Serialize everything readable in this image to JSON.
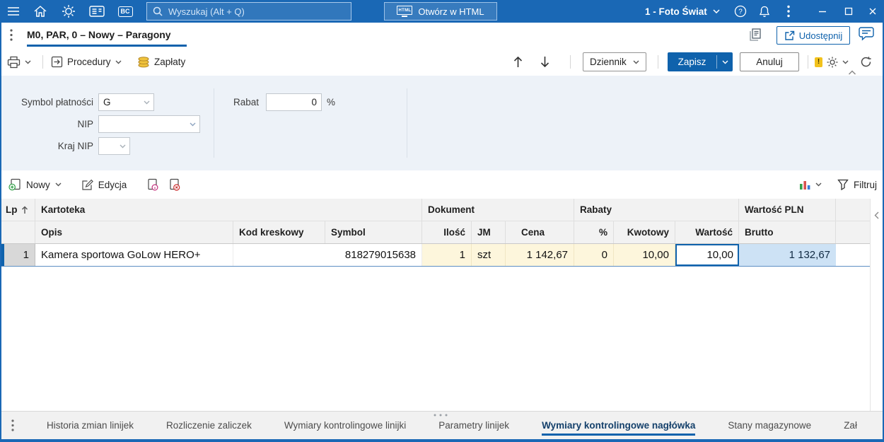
{
  "colors": {
    "topbar_blue": "#1a68b5",
    "accent_blue": "#0f62ac",
    "row_highlight_yellow": "#fdf6dc",
    "cell_highlight_blue": "#cde2f5"
  },
  "topbar": {
    "bc_badge": "BC",
    "search_placeholder": "Wyszukaj (Alt + Q)",
    "open_html_button": "Otwórz w HTML",
    "html_icon_text": "HTML",
    "company_name": "1 - Foto Świat"
  },
  "page_header": {
    "title": "M0, PAR, 0 – Nowy – Paragony",
    "share_button": "Udostępnij"
  },
  "toolbar": {
    "procedures": "Procedury",
    "payments": "Zapłaty",
    "journal_select": "Dziennik",
    "save_button": "Zapisz",
    "cancel_button": "Anuluj",
    "warning_badge": "!"
  },
  "form": {
    "symbol_platnosci_label": "Symbol płatności",
    "symbol_platnosci_value": "G",
    "nip_label": "NIP",
    "nip_value": "",
    "kraj_nip_label": "Kraj NIP",
    "kraj_nip_value": "",
    "rabat_label": "Rabat",
    "rabat_value": "0",
    "rabat_suffix": "%"
  },
  "grid_toolbar": {
    "new": "Nowy",
    "edit": "Edycja",
    "filter": "Filtruj"
  },
  "table": {
    "group_headers": {
      "lp": "Lp",
      "kartoteka": "Kartoteka",
      "dokument": "Dokument",
      "rabaty": "Rabaty",
      "wartosc_pln": "Wartość PLN"
    },
    "columns": {
      "opis": "Opis",
      "kod_kreskowy": "Kod kreskowy",
      "symbol": "Symbol",
      "ilosc": "Ilość",
      "jm": "JM",
      "cena": "Cena",
      "procent": "%",
      "kwotowy": "Kwotowy",
      "wartosc": "Wartość",
      "brutto": "Brutto"
    },
    "rows": [
      {
        "lp": "1",
        "opis": "Kamera sportowa GoLow HERO+",
        "kod_kreskowy": "818279015638",
        "symbol": "",
        "ilosc": "1",
        "jm": "szt",
        "cena": "1 142,67",
        "rabat_procent": "0",
        "rabat_kwotowy": "10,00",
        "wartosc": "10,00",
        "brutto": "1 132,67"
      }
    ]
  },
  "bottom_tabs": [
    {
      "label": "Historia zmian linijek",
      "active": false
    },
    {
      "label": "Rozliczenie zaliczek",
      "active": false
    },
    {
      "label": "Wymiary kontrolingowe linijki",
      "active": false
    },
    {
      "label": "Parametry linijek",
      "active": false
    },
    {
      "label": "Wymiary kontrolingowe nagłówka",
      "active": true
    },
    {
      "label": "Stany magazynowe",
      "active": false
    },
    {
      "label": "Zał",
      "active": false
    }
  ]
}
